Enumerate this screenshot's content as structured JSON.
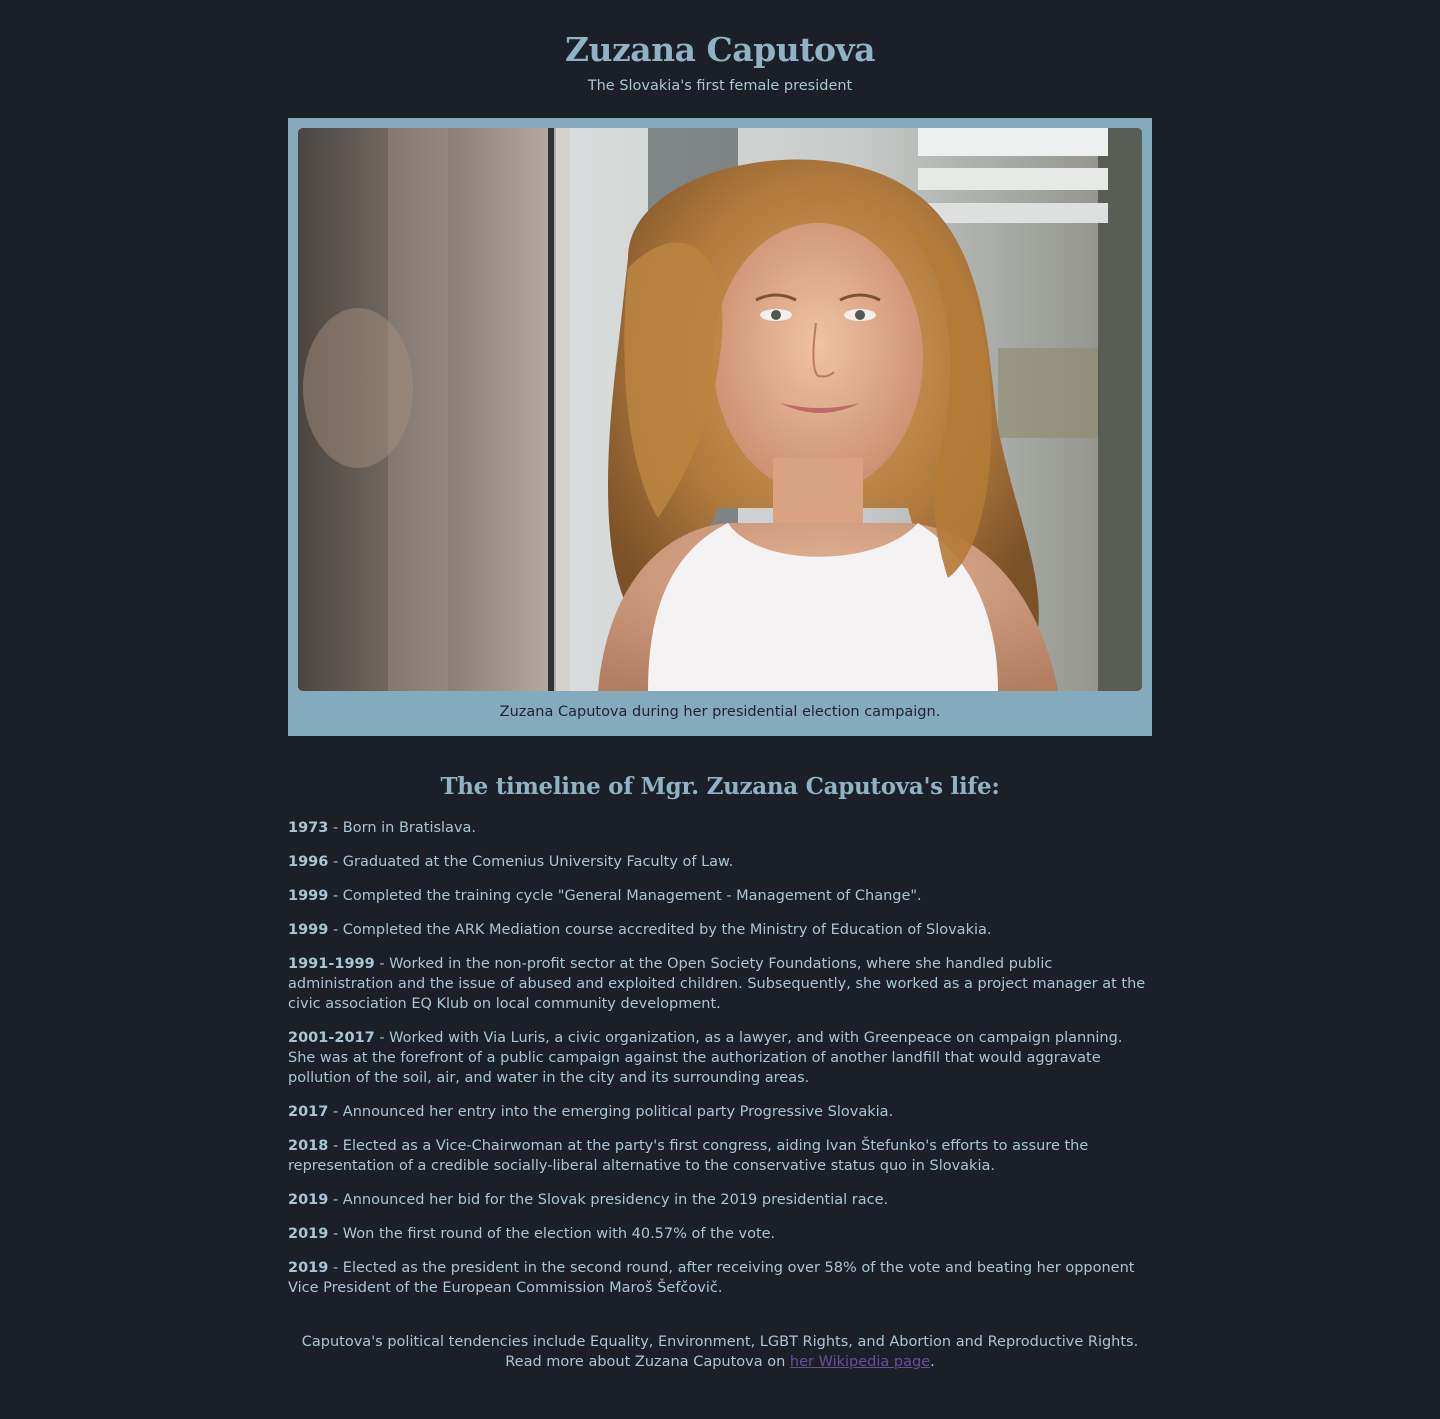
{
  "header": {
    "title": "Zuzana Caputova",
    "subtitle": "The Slovakia's first female president"
  },
  "figure": {
    "image_alt": "Portrait photo of Zuzana Caputova",
    "caption": "Zuzana Caputova during her presidential election campaign."
  },
  "timeline": {
    "heading": "The timeline of Mgr. Zuzana Caputova's life:",
    "items": [
      {
        "year": "1973",
        "text": " - Born in Bratislava."
      },
      {
        "year": "1996",
        "text": " - Graduated at the Comenius University Faculty of Law."
      },
      {
        "year": "1999",
        "text": " - Completed the training cycle \"General Management - Management of Change\"."
      },
      {
        "year": "1999",
        "text": " - Completed the ARK Mediation course accredited by the Ministry of Education of Slovakia."
      },
      {
        "year": "1991-1999",
        "text": " - Worked in the non-profit sector at the Open Society Foundations, where she handled public administration and the issue of abused and exploited children. Subsequently, she worked as a project manager at the civic association EQ Klub on local community development."
      },
      {
        "year": "2001-2017",
        "text": " - Worked with Via Luris, a civic organization, as a lawyer, and with Greenpeace on campaign planning. She was at the forefront of a public campaign against the authorization of another landfill that would aggravate pollution of the soil, air, and water in the city and its surrounding areas."
      },
      {
        "year": "2017",
        "text": " - Announced her entry into the emerging political party Progressive Slovakia."
      },
      {
        "year": "2018",
        "text": " - Elected as a Vice-Chairwoman at the party's first congress, aiding Ivan Štefunko's efforts to assure the representation of a credible socially-liberal alternative to the conservative status quo in Slovakia."
      },
      {
        "year": "2019",
        "text": " - Announced her bid for the Slovak presidency in the 2019 presidential race."
      },
      {
        "year": "2019",
        "text": " - Won the first round of the election with 40.57% of the vote."
      },
      {
        "year": "2019",
        "text": " - Elected as the president in the second round, after receiving over 58% of the vote and beating her opponent Vice President of the European Commission Maroš Šefčovič."
      }
    ]
  },
  "footer": {
    "text_before": "Caputova's political tendencies include Equality, Environment, LGBT Rights, and Abortion and Reproductive Rights. Read more about Zuzana Caputova on ",
    "link_label": "her Wikipedia page",
    "text_after": "."
  },
  "colors": {
    "background": "#1b1f27",
    "accent": "#8fb3c5",
    "figure_bg": "#84aabd",
    "link": "#6b4c9a"
  }
}
